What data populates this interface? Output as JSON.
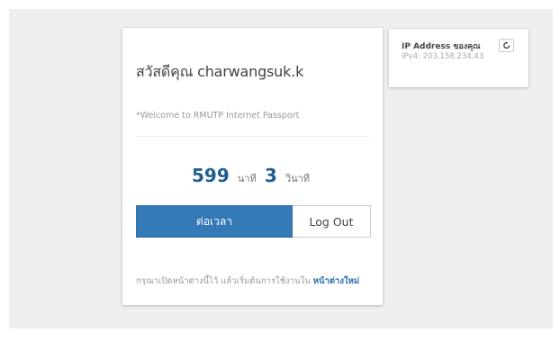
{
  "login_card": {
    "greeting": "สวัสดีคุณ charwangsuk.k",
    "welcome": "*Welcome to RMUTP Internet Passport",
    "timer": {
      "minutes": "599",
      "minutes_unit": "นาที",
      "seconds": "3",
      "seconds_unit": "วินาที"
    },
    "extend_button": "ต่อเวลา",
    "logout_button": "Log Out",
    "footer_text": "กรุณาเปิดหน้าต่างนี้ไว้ แล้วเริ่มต้นการใช้งานใน",
    "footer_link": "หน้าต่างใหม่"
  },
  "ip_card": {
    "title": "IP Address ของคุณ",
    "value": "IPv4: 203.158.234.43",
    "refresh_icon": "refresh-icon"
  },
  "colors": {
    "primary": "#337ab7",
    "timer_number": "#1f5f8f",
    "link": "#2a6fb0",
    "background": "#efefef"
  }
}
